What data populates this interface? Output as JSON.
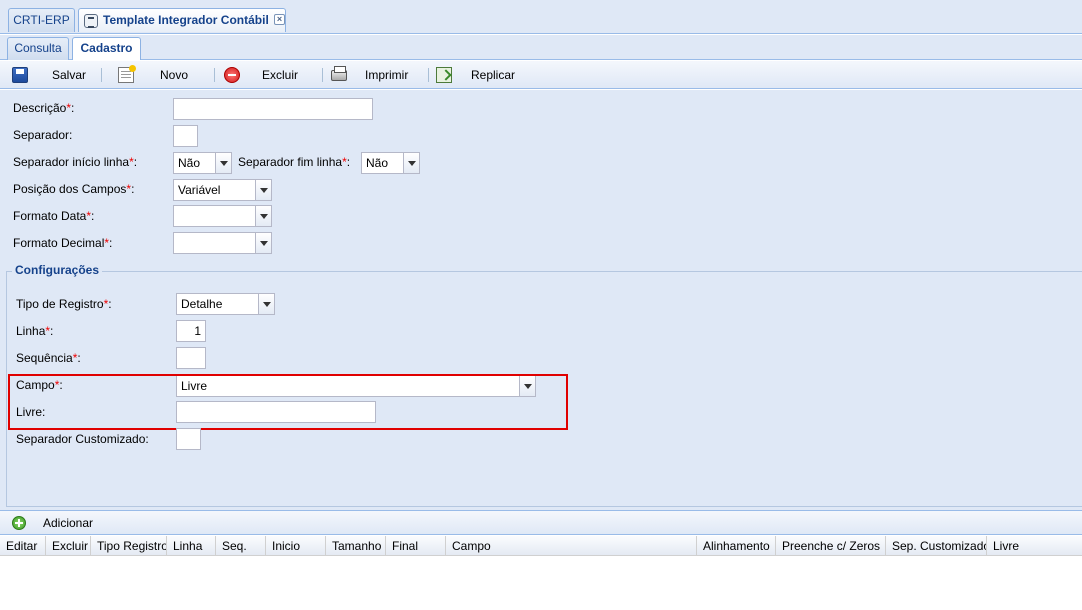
{
  "top_tabs": [
    {
      "label": "CRTI-ERP"
    },
    {
      "label": "Template Integrador Contábil",
      "close": "×"
    }
  ],
  "sub_tabs": [
    {
      "label": "Consulta"
    },
    {
      "label": "Cadastro"
    }
  ],
  "toolbar": {
    "save": "Salvar",
    "new": "Novo",
    "delete": "Excluir",
    "print": "Imprimir",
    "replicate": "Replicar"
  },
  "form": {
    "descricao": {
      "label": "Descrição",
      "value": ""
    },
    "separador": {
      "label": "Separador:",
      "value": ""
    },
    "sep_inicio": {
      "label": "Separador início linha",
      "value": "Não"
    },
    "sep_fim": {
      "label": "Separador fim linha",
      "value": "Não"
    },
    "posicao": {
      "label": "Posição dos Campos",
      "value": "Variável"
    },
    "formato_data": {
      "label": "Formato Data",
      "value": ""
    },
    "formato_decimal": {
      "label": "Formato Decimal",
      "value": ""
    }
  },
  "config": {
    "legend": "Configurações",
    "tipo_registro": {
      "label": "Tipo de Registro",
      "value": "Detalhe"
    },
    "linha": {
      "label": "Linha",
      "value": "1"
    },
    "sequencia": {
      "label": "Sequência",
      "value": ""
    },
    "campo": {
      "label": "Campo",
      "value": "Livre"
    },
    "livre": {
      "label": "Livre:",
      "value": ""
    },
    "sep_custom": {
      "label": "Separador Customizado:",
      "value": ""
    }
  },
  "required_mark": "*",
  "colon": ":",
  "grid": {
    "add_label": "Adicionar",
    "columns": [
      "Editar",
      "Excluir",
      "Tipo Registro",
      "Linha",
      "Seq.",
      "Inicio",
      "Tamanho",
      "Final",
      "Campo",
      "Alinhamento",
      "Preenche c/ Zeros",
      "Sep. Customizado",
      "Livre"
    ]
  },
  "colors": {
    "panel_bg": "#dfe8f6",
    "border": "#99bbe8",
    "accent_text": "#15428b",
    "required": "#ee0000",
    "highlight": "#e00000"
  }
}
